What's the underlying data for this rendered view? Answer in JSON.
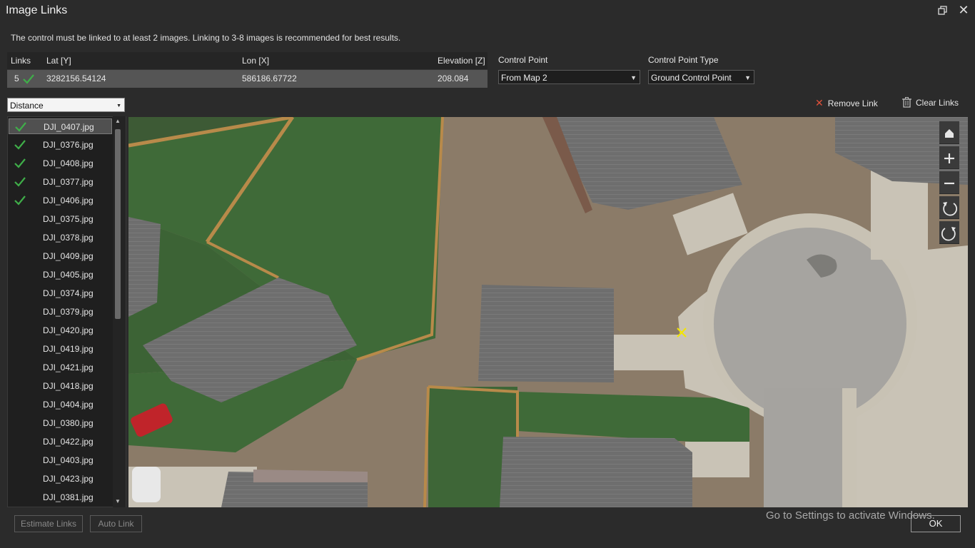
{
  "window": {
    "title": "Image Links"
  },
  "info_text": "The control must be linked to at least 2 images. Linking to 3-8 images is recommended for best results.",
  "grid": {
    "headers": {
      "links": "Links",
      "lat": "Lat [Y]",
      "lon": "Lon [X]",
      "elevation": "Elevation [Z]"
    },
    "row": {
      "links": "5",
      "lat": "3282156.54124",
      "lon": "586186.67722",
      "elevation": "208.084"
    }
  },
  "control_point": {
    "label": "Control Point",
    "value": "From Map 2"
  },
  "control_point_type": {
    "label": "Control Point Type",
    "value": "Ground Control Point"
  },
  "sort": {
    "value": "Distance"
  },
  "toolbar": {
    "remove_link": "Remove Link",
    "clear_links": "Clear Links"
  },
  "images": [
    {
      "name": "DJI_0407.jpg",
      "linked": true,
      "selected": true
    },
    {
      "name": "DJI_0376.jpg",
      "linked": true
    },
    {
      "name": "DJI_0408.jpg",
      "linked": true
    },
    {
      "name": "DJI_0377.jpg",
      "linked": true
    },
    {
      "name": "DJI_0406.jpg",
      "linked": true
    },
    {
      "name": "DJI_0375.jpg",
      "linked": false
    },
    {
      "name": "DJI_0378.jpg",
      "linked": false
    },
    {
      "name": "DJI_0409.jpg",
      "linked": false
    },
    {
      "name": "DJI_0405.jpg",
      "linked": false
    },
    {
      "name": "DJI_0374.jpg",
      "linked": false
    },
    {
      "name": "DJI_0379.jpg",
      "linked": false
    },
    {
      "name": "DJI_0420.jpg",
      "linked": false
    },
    {
      "name": "DJI_0419.jpg",
      "linked": false
    },
    {
      "name": "DJI_0421.jpg",
      "linked": false
    },
    {
      "name": "DJI_0418.jpg",
      "linked": false
    },
    {
      "name": "DJI_0404.jpg",
      "linked": false
    },
    {
      "name": "DJI_0380.jpg",
      "linked": false
    },
    {
      "name": "DJI_0422.jpg",
      "linked": false
    },
    {
      "name": "DJI_0403.jpg",
      "linked": false
    },
    {
      "name": "DJI_0423.jpg",
      "linked": false
    },
    {
      "name": "DJI_0381.jpg",
      "linked": false
    }
  ],
  "map_nav": [
    "home-icon",
    "zoom-in-icon",
    "zoom-out-icon",
    "rotate-left-icon",
    "rotate-right-icon"
  ],
  "buttons": {
    "estimate": "Estimate Links",
    "auto": "Auto Link",
    "ok": "OK"
  },
  "watermark": "Go to Settings to activate Windows.",
  "colors": {
    "accent_check": "#3fae49",
    "marker": "#f2e600",
    "remove_icon": "#e0503a"
  }
}
